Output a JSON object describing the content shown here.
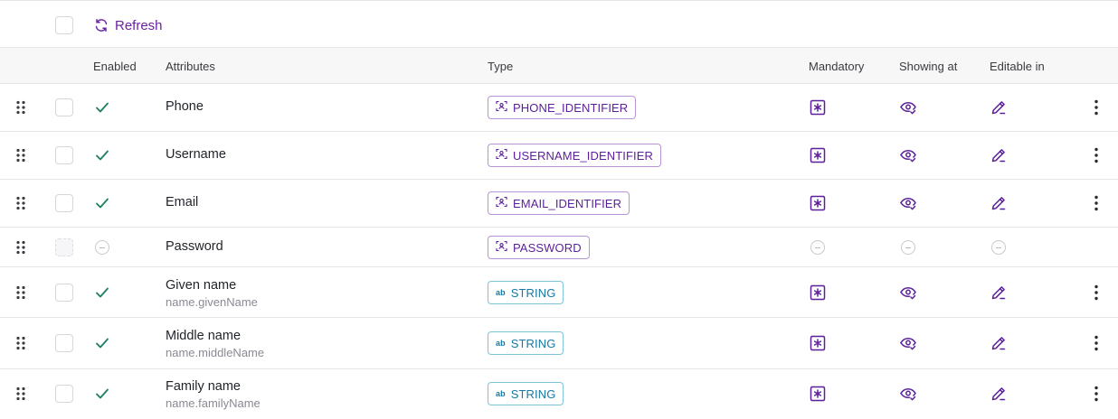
{
  "toolbar": {
    "refresh_label": "Refresh"
  },
  "columns": {
    "enabled": "Enabled",
    "attributes": "Attributes",
    "type": "Type",
    "mandatory": "Mandatory",
    "showing_at": "Showing at",
    "editable_in": "Editable in"
  },
  "colors": {
    "accent": "#6b21a8",
    "check": "#1a7f64",
    "identifier": "#5b1f9a",
    "string": "#1679a3"
  },
  "rows": [
    {
      "name": "Phone",
      "key": "",
      "type": "PHONE_IDENTIFIER",
      "type_icon": "identifier-icon",
      "enabled": true
    },
    {
      "name": "Username",
      "key": "",
      "type": "USERNAME_IDENTIFIER",
      "type_icon": "identifier-icon",
      "enabled": true
    },
    {
      "name": "Email",
      "key": "",
      "type": "EMAIL_IDENTIFIER",
      "type_icon": "identifier-icon",
      "enabled": true
    },
    {
      "name": "Password",
      "key": "",
      "type": "PASSWORD",
      "type_icon": "identifier-icon",
      "enabled": false
    },
    {
      "name": "Given name",
      "key": "name.givenName",
      "type": "STRING",
      "type_icon": "ab",
      "enabled": true
    },
    {
      "name": "Middle name",
      "key": "name.middleName",
      "type": "STRING",
      "type_icon": "ab",
      "enabled": true
    },
    {
      "name": "Family name",
      "key": "name.familyName",
      "type": "STRING",
      "type_icon": "ab",
      "enabled": true
    }
  ]
}
